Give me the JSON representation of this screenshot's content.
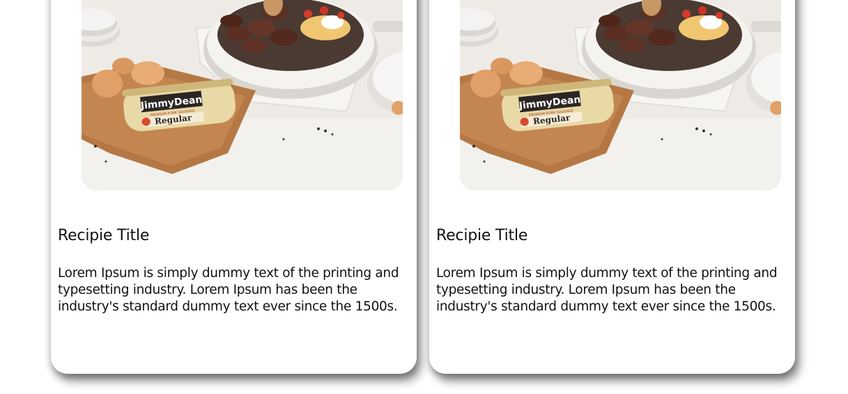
{
  "cards": [
    {
      "title": "Recipie Title",
      "description": "Lorem Ipsum is simply dummy text of the printing and typesetting industry. Lorem Ipsum has been the industry's standard dummy text ever since the 1500s.",
      "image": {
        "brand_text": "JimmyDean",
        "package_text": "Regular",
        "subtext": "PREMIUM PORK SAUSAGE"
      }
    },
    {
      "title": "Recipie Title",
      "description": "Lorem Ipsum is simply dummy text of the printing and typesetting industry. Lorem Ipsum has been the industry's standard dummy text ever since the 1500s.",
      "image": {
        "brand_text": "JimmyDean",
        "package_text": "Regular",
        "subtext": "PREMIUM PORK SAUSAGE"
      }
    }
  ]
}
